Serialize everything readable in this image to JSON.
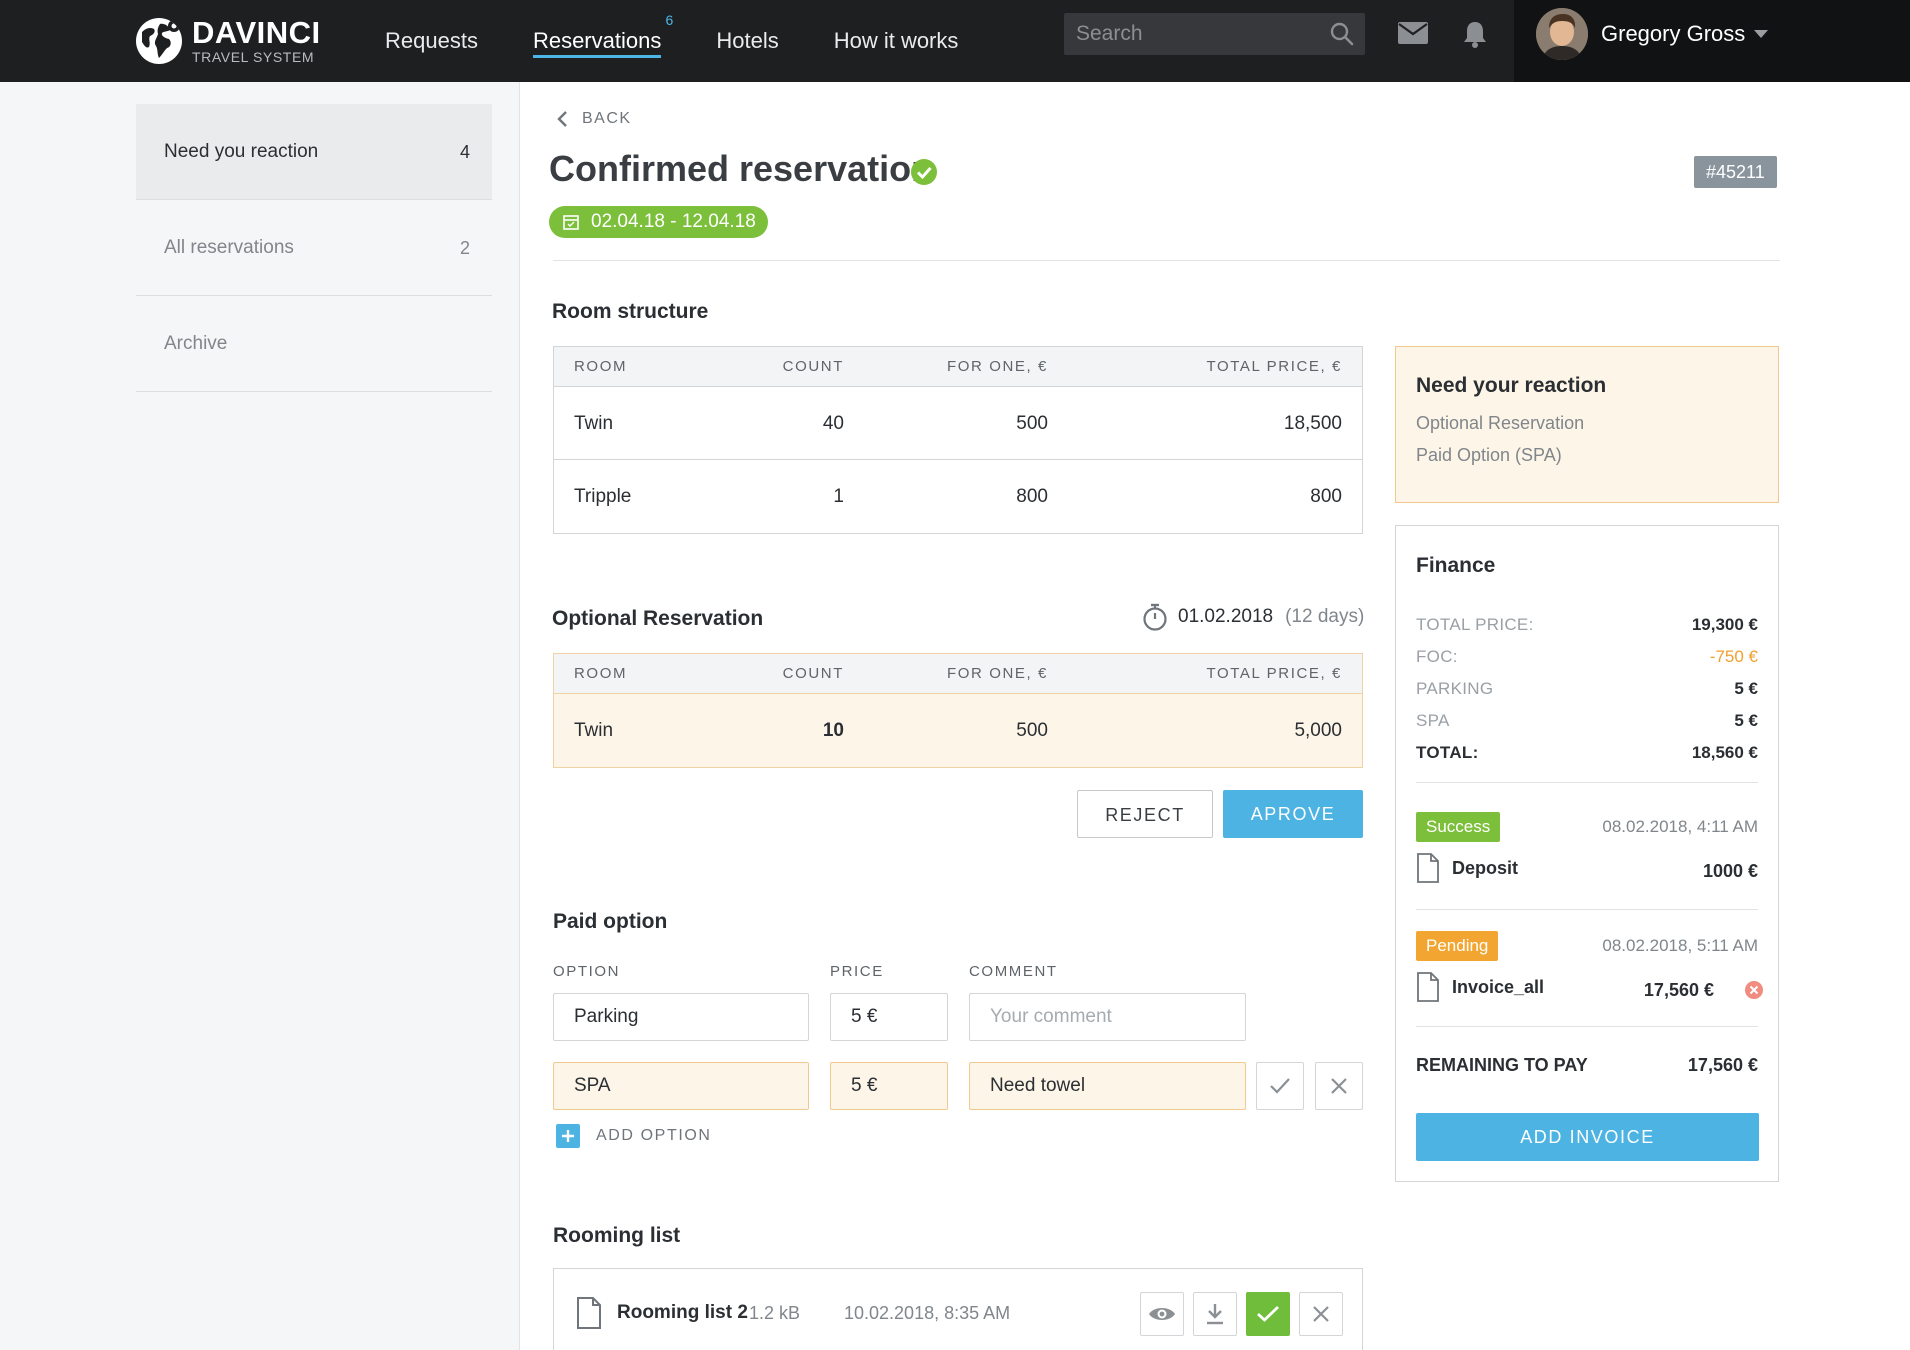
{
  "brand": {
    "name": "DAVINCI",
    "subtitle": "TRAVEL SYSTEM"
  },
  "nav": {
    "items": [
      {
        "label": "Requests"
      },
      {
        "label": "Reservations",
        "badge": "6"
      },
      {
        "label": "Hotels"
      },
      {
        "label": "How it works"
      }
    ],
    "active": "Reservations"
  },
  "search": {
    "placeholder": "Search"
  },
  "user": {
    "name": "Gregory Gross"
  },
  "sidebar": {
    "items": [
      {
        "label": "Need you reaction",
        "count": "4"
      },
      {
        "label": "All reservations",
        "count": "2"
      },
      {
        "label": "Archive",
        "count": ""
      }
    ]
  },
  "page": {
    "back_label": "BACK",
    "title": "Confirmed reservation",
    "date_range": "02.04.18 - 12.04.18",
    "reservation_id": "#45211"
  },
  "room_structure": {
    "title": "Room structure",
    "columns": [
      "ROOM",
      "COUNT",
      "FOR ONE, €",
      "TOTAL PRICE, €"
    ],
    "rows": [
      {
        "room": "Twin",
        "count": "40",
        "for_one": "500",
        "total": "18,500"
      },
      {
        "room": "Tripple",
        "count": "1",
        "for_one": "800",
        "total": "800"
      }
    ]
  },
  "optional_reservation": {
    "title": "Optional Reservation",
    "date": "01.02.2018",
    "days": "(12 days)",
    "columns": [
      "ROOM",
      "COUNT",
      "FOR ONE, €",
      "TOTAL PRICE, €"
    ],
    "rows": [
      {
        "room": "Twin",
        "count": "10",
        "for_one": "500",
        "total": "5,000"
      }
    ],
    "reject_label": "REJECT",
    "approve_label": "APROVE"
  },
  "paid_option": {
    "title": "Paid option",
    "labels": {
      "option": "OPTION",
      "price": "PRICE",
      "comment": "COMMENT"
    },
    "rows": [
      {
        "option": "Parking",
        "price": "5 €",
        "comment": "",
        "comment_placeholder": "Your comment"
      },
      {
        "option": "SPA",
        "price": "5 €",
        "comment": "Need towel"
      }
    ],
    "add_label": "ADD OPTION"
  },
  "rooming_list": {
    "title": "Rooming list",
    "file": {
      "name": "Rooming list 2",
      "size": "1.2 kB",
      "date": "10.02.2018,  8:35 AM"
    }
  },
  "reaction": {
    "title": "Need your reaction",
    "items": [
      "Optional Reservation",
      "Paid Option (SPA)"
    ]
  },
  "finance": {
    "title": "Finance",
    "rows": [
      {
        "label": "TOTAL PRICE:",
        "value": "19,300 €"
      },
      {
        "label": "FOC:",
        "value": "-750 €"
      },
      {
        "label": "PARKING",
        "value": "5 €"
      },
      {
        "label": "SPA",
        "value": "5 €"
      },
      {
        "label": "TOTAL:",
        "value": "18,560 €"
      }
    ],
    "payments": [
      {
        "status": "Success",
        "date": "08.02.2018,  4:11 AM",
        "doc": "Deposit",
        "amount": "1000 €"
      },
      {
        "status": "Pending",
        "date": "08.02.2018,  5:11 AM",
        "doc": "Invoice_all",
        "amount": "17,560 €"
      }
    ],
    "remaining_label": "REMAINING TO PAY",
    "remaining_value": "17,560 €",
    "add_invoice_label": "ADD INVOICE"
  },
  "colors": {
    "accent": "#4cb3e3",
    "success": "#7bbf3b",
    "pending": "#f2a530",
    "warning_bg": "#fdf5e8"
  }
}
